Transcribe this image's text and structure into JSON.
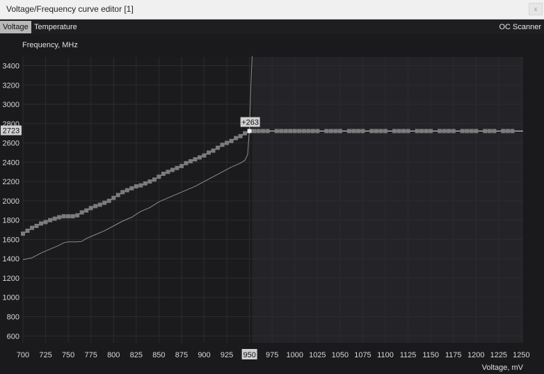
{
  "window": {
    "title": "Voltage/Frequency curve editor [1]",
    "close_glyph": "x"
  },
  "tabs": {
    "voltage": "Voltage",
    "temperature": "Temperature",
    "oc_scanner": "OC Scanner"
  },
  "chart_data": {
    "type": "line",
    "ylabel": "Frequency, MHz",
    "xlabel": "Voltage, mV",
    "x_ticks": [
      700,
      725,
      750,
      775,
      800,
      825,
      850,
      875,
      900,
      925,
      950,
      975,
      1000,
      1025,
      1050,
      1075,
      1100,
      1125,
      1150,
      1175,
      1200,
      1225,
      1250
    ],
    "y_ticks": [
      600,
      800,
      1000,
      1200,
      1400,
      1600,
      1800,
      2000,
      2200,
      2400,
      2600,
      2800,
      3000,
      3200,
      3400
    ],
    "xlim": [
      700,
      1252
    ],
    "ylim": [
      530,
      3490
    ],
    "grid": true,
    "selected_point": {
      "voltage": 950,
      "frequency": 2723,
      "offset_label": "+263"
    },
    "readouts": {
      "x": "950",
      "y": "2723"
    },
    "flat_region_start": 950,
    "flat_frequency": 2723,
    "series": [
      {
        "name": "",
        "role": "edited-curve",
        "color": "#7a7a7a",
        "points": [
          [
            700,
            1660
          ],
          [
            705,
            1690
          ],
          [
            710,
            1720
          ],
          [
            715,
            1740
          ],
          [
            720,
            1765
          ],
          [
            725,
            1780
          ],
          [
            730,
            1800
          ],
          [
            735,
            1815
          ],
          [
            740,
            1830
          ],
          [
            745,
            1840
          ],
          [
            750,
            1840
          ],
          [
            755,
            1840
          ],
          [
            760,
            1850
          ],
          [
            765,
            1880
          ],
          [
            770,
            1900
          ],
          [
            775,
            1925
          ],
          [
            780,
            1945
          ],
          [
            785,
            1960
          ],
          [
            790,
            1980
          ],
          [
            795,
            2000
          ],
          [
            800,
            2030
          ],
          [
            805,
            2060
          ],
          [
            810,
            2090
          ],
          [
            815,
            2110
          ],
          [
            820,
            2130
          ],
          [
            825,
            2150
          ],
          [
            830,
            2160
          ],
          [
            835,
            2180
          ],
          [
            840,
            2200
          ],
          [
            845,
            2220
          ],
          [
            850,
            2250
          ],
          [
            855,
            2280
          ],
          [
            860,
            2300
          ],
          [
            865,
            2320
          ],
          [
            870,
            2340
          ],
          [
            875,
            2360
          ],
          [
            880,
            2390
          ],
          [
            885,
            2410
          ],
          [
            890,
            2430
          ],
          [
            895,
            2450
          ],
          [
            900,
            2470
          ],
          [
            905,
            2500
          ],
          [
            910,
            2520
          ],
          [
            915,
            2550
          ],
          [
            920,
            2580
          ],
          [
            925,
            2600
          ],
          [
            930,
            2620
          ],
          [
            935,
            2650
          ],
          [
            940,
            2670
          ],
          [
            945,
            2700
          ],
          [
            950,
            2723
          ],
          [
            955,
            2723
          ],
          [
            960,
            2723
          ],
          [
            965,
            2723
          ],
          [
            970,
            2723
          ],
          [
            980,
            2723
          ],
          [
            985,
            2723
          ],
          [
            990,
            2723
          ],
          [
            995,
            2723
          ],
          [
            1000,
            2723
          ],
          [
            1005,
            2723
          ],
          [
            1010,
            2723
          ],
          [
            1015,
            2723
          ],
          [
            1020,
            2723
          ],
          [
            1025,
            2723
          ],
          [
            1035,
            2723
          ],
          [
            1040,
            2723
          ],
          [
            1045,
            2723
          ],
          [
            1050,
            2723
          ],
          [
            1060,
            2723
          ],
          [
            1065,
            2723
          ],
          [
            1070,
            2723
          ],
          [
            1075,
            2723
          ],
          [
            1085,
            2723
          ],
          [
            1090,
            2723
          ],
          [
            1095,
            2723
          ],
          [
            1100,
            2723
          ],
          [
            1110,
            2723
          ],
          [
            1115,
            2723
          ],
          [
            1120,
            2723
          ],
          [
            1125,
            2723
          ],
          [
            1135,
            2723
          ],
          [
            1140,
            2723
          ],
          [
            1145,
            2723
          ],
          [
            1150,
            2723
          ],
          [
            1160,
            2723
          ],
          [
            1165,
            2723
          ],
          [
            1170,
            2723
          ],
          [
            1175,
            2723
          ],
          [
            1185,
            2723
          ],
          [
            1190,
            2723
          ],
          [
            1195,
            2723
          ],
          [
            1200,
            2723
          ],
          [
            1210,
            2723
          ],
          [
            1215,
            2723
          ],
          [
            1220,
            2723
          ],
          [
            1230,
            2723
          ],
          [
            1235,
            2723
          ],
          [
            1240,
            2723
          ]
        ]
      },
      {
        "name": "",
        "role": "base-curve",
        "color": "#8a8a8a",
        "points": [
          [
            700,
            1390
          ],
          [
            710,
            1410
          ],
          [
            720,
            1460
          ],
          [
            730,
            1500
          ],
          [
            740,
            1540
          ],
          [
            745,
            1565
          ],
          [
            750,
            1575
          ],
          [
            760,
            1575
          ],
          [
            765,
            1580
          ],
          [
            770,
            1610
          ],
          [
            780,
            1650
          ],
          [
            790,
            1690
          ],
          [
            800,
            1740
          ],
          [
            810,
            1790
          ],
          [
            820,
            1830
          ],
          [
            825,
            1860
          ],
          [
            830,
            1890
          ],
          [
            840,
            1930
          ],
          [
            850,
            1990
          ],
          [
            860,
            2030
          ],
          [
            870,
            2070
          ],
          [
            880,
            2110
          ],
          [
            890,
            2150
          ],
          [
            900,
            2200
          ],
          [
            910,
            2250
          ],
          [
            920,
            2300
          ],
          [
            930,
            2350
          ],
          [
            940,
            2390
          ],
          [
            945,
            2420
          ],
          [
            948,
            2480
          ],
          [
            950,
            2750
          ],
          [
            951,
            3000
          ],
          [
            952,
            3300
          ],
          [
            953,
            3500
          ]
        ]
      }
    ]
  }
}
